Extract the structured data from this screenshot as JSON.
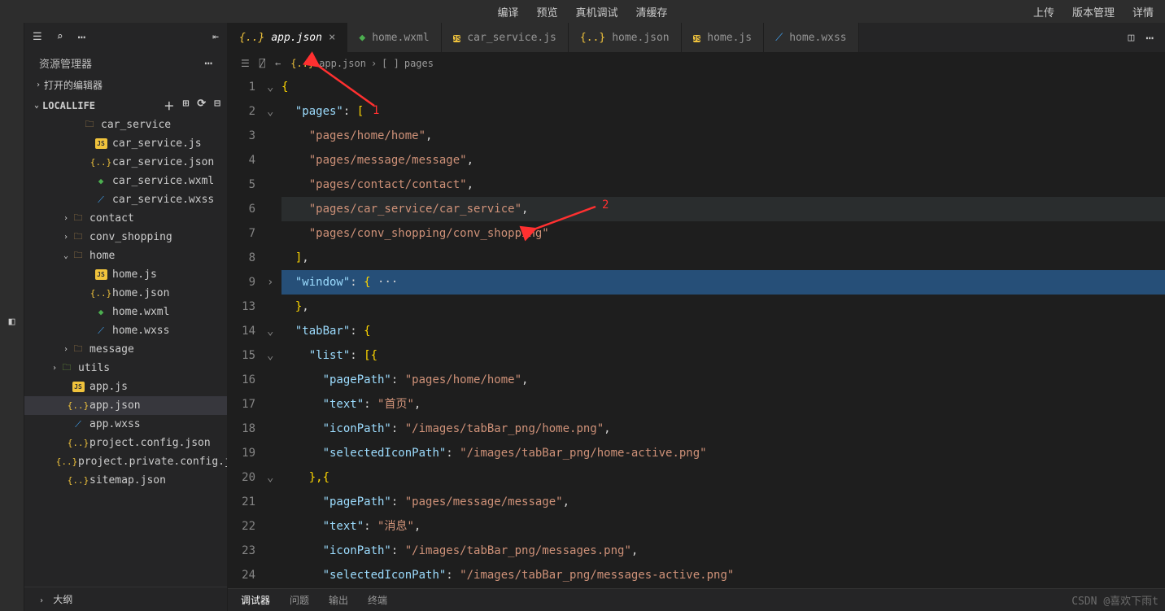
{
  "topMenu": {
    "center": [
      "编译",
      "预览",
      "真机调试",
      "清缓存"
    ],
    "right": [
      "上传",
      "版本管理",
      "详情"
    ]
  },
  "sidebar": {
    "title": "资源管理器",
    "sections": {
      "openEditors": "打开的编辑器",
      "project": "LOCALLIFE"
    },
    "tree": [
      {
        "indent": 2,
        "chev": "",
        "icon": "folder",
        "label": "car_service"
      },
      {
        "indent": 3,
        "chev": "",
        "icon": "js",
        "label": "car_service.js"
      },
      {
        "indent": 3,
        "chev": "",
        "icon": "json",
        "label": "car_service.json"
      },
      {
        "indent": 3,
        "chev": "",
        "icon": "wxml",
        "label": "car_service.wxml"
      },
      {
        "indent": 3,
        "chev": "",
        "icon": "wxss",
        "label": "car_service.wxss"
      },
      {
        "indent": 1,
        "chev": "›",
        "icon": "folder",
        "label": "contact"
      },
      {
        "indent": 1,
        "chev": "›",
        "icon": "folder",
        "label": "conv_shopping"
      },
      {
        "indent": 1,
        "chev": "⌄",
        "icon": "folder",
        "label": "home"
      },
      {
        "indent": 3,
        "chev": "",
        "icon": "js",
        "label": "home.js"
      },
      {
        "indent": 3,
        "chev": "",
        "icon": "json",
        "label": "home.json"
      },
      {
        "indent": 3,
        "chev": "",
        "icon": "wxml",
        "label": "home.wxml"
      },
      {
        "indent": 3,
        "chev": "",
        "icon": "wxss",
        "label": "home.wxss"
      },
      {
        "indent": 1,
        "chev": "›",
        "icon": "folder",
        "label": "message"
      },
      {
        "indent": 0,
        "chev": "›",
        "icon": "folder-green",
        "label": "utils"
      },
      {
        "indent": 1,
        "chev": "",
        "icon": "js",
        "label": "app.js"
      },
      {
        "indent": 1,
        "chev": "",
        "icon": "json",
        "label": "app.json",
        "selected": true
      },
      {
        "indent": 1,
        "chev": "",
        "icon": "wxss",
        "label": "app.wxss"
      },
      {
        "indent": 1,
        "chev": "",
        "icon": "json",
        "label": "project.config.json"
      },
      {
        "indent": 1,
        "chev": "",
        "icon": "json",
        "label": "project.private.config.json"
      },
      {
        "indent": 1,
        "chev": "",
        "icon": "json",
        "label": "sitemap.json"
      }
    ],
    "outline": "大纲"
  },
  "tabs": [
    {
      "icon": "json",
      "label": "app.json",
      "active": true,
      "close": true
    },
    {
      "icon": "wxml",
      "label": "home.wxml"
    },
    {
      "icon": "js",
      "label": "car_service.js"
    },
    {
      "icon": "json",
      "label": "home.json"
    },
    {
      "icon": "js",
      "label": "home.js"
    },
    {
      "icon": "wxss",
      "label": "home.wxss"
    }
  ],
  "breadcrumb": {
    "file": "app.json",
    "segment": "pages"
  },
  "code": {
    "lines": [
      {
        "n": 1,
        "fold": "⌄",
        "html": "<span class='b'>{</span>"
      },
      {
        "n": 2,
        "fold": "⌄",
        "html": "  <span class='k'>\"pages\"</span><span class='p'>: </span><span class='b'>[</span>"
      },
      {
        "n": 3,
        "fold": "",
        "html": "    <span class='s'>\"pages/home/home\"</span><span class='p'>,</span>"
      },
      {
        "n": 4,
        "fold": "",
        "html": "    <span class='s'>\"pages/message/message\"</span><span class='p'>,</span>"
      },
      {
        "n": 5,
        "fold": "",
        "html": "    <span class='s'>\"pages/contact/contact\"</span><span class='p'>,</span>"
      },
      {
        "n": 6,
        "fold": "",
        "html": "    <span class='s'>\"pages/car_service/car_service\"</span><span class='p'>,</span>",
        "hl": true
      },
      {
        "n": 7,
        "fold": "",
        "html": "    <span class='s'>\"pages/conv_shopping/conv_shopping\"</span>"
      },
      {
        "n": 8,
        "fold": "",
        "html": "  <span class='b'>]</span><span class='p'>,</span>"
      },
      {
        "n": 9,
        "fold": "›",
        "html": "  <span class='k'>\"window\"</span><span class='p'>: </span><span class='b'>{</span><span class='p'> ···</span>",
        "hlStrong": true
      },
      {
        "n": 13,
        "fold": "",
        "html": "  <span class='b'>}</span><span class='p'>,</span>"
      },
      {
        "n": 14,
        "fold": "⌄",
        "html": "  <span class='k'>\"tabBar\"</span><span class='p'>: </span><span class='b'>{</span>"
      },
      {
        "n": 15,
        "fold": "⌄",
        "html": "    <span class='k'>\"list\"</span><span class='p'>: </span><span class='b'>[{</span>"
      },
      {
        "n": 16,
        "fold": "",
        "html": "      <span class='k'>\"pagePath\"</span><span class='p'>: </span><span class='s'>\"pages/home/home\"</span><span class='p'>,</span>"
      },
      {
        "n": 17,
        "fold": "",
        "html": "      <span class='k'>\"text\"</span><span class='p'>: </span><span class='s'>\"首页\"</span><span class='p'>,</span>"
      },
      {
        "n": 18,
        "fold": "",
        "html": "      <span class='k'>\"iconPath\"</span><span class='p'>: </span><span class='s'>\"/images/tabBar_png/home.png\"</span><span class='p'>,</span>"
      },
      {
        "n": 19,
        "fold": "",
        "html": "      <span class='k'>\"selectedIconPath\"</span><span class='p'>: </span><span class='s'>\"/images/tabBar_png/home-active.png\"</span>"
      },
      {
        "n": 20,
        "fold": "⌄",
        "html": "    <span class='b'>},{</span>"
      },
      {
        "n": 21,
        "fold": "",
        "html": "      <span class='k'>\"pagePath\"</span><span class='p'>: </span><span class='s'>\"pages/message/message\"</span><span class='p'>,</span>"
      },
      {
        "n": 22,
        "fold": "",
        "html": "      <span class='k'>\"text\"</span><span class='p'>: </span><span class='s'>\"消息\"</span><span class='p'>,</span>"
      },
      {
        "n": 23,
        "fold": "",
        "html": "      <span class='k'>\"iconPath\"</span><span class='p'>: </span><span class='s'>\"/images/tabBar_png/messages.png\"</span><span class='p'>,</span>"
      },
      {
        "n": 24,
        "fold": "",
        "html": "      <span class='k'>\"selectedIconPath\"</span><span class='p'>: </span><span class='s'>\"/images/tabBar_png/messages-active.png\"</span>"
      }
    ]
  },
  "annotations": {
    "a1": "1",
    "a2": "2"
  },
  "bottomPanel": [
    "调试器",
    "问题",
    "输出",
    "终端"
  ],
  "watermark": "CSDN @喜欢下雨t"
}
